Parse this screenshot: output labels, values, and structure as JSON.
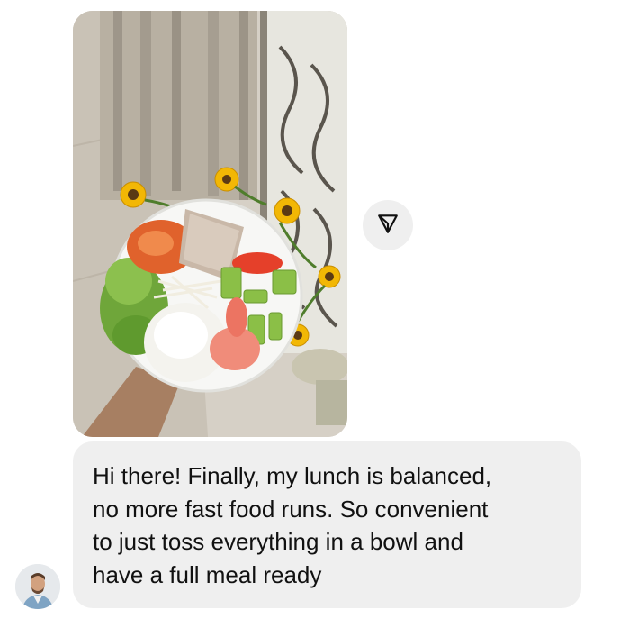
{
  "message": {
    "text": "Hi there! Finally, my lunch is balanced,\nno more fast food runs. So convenient\nto just toss everything in a bowl and\nhave a full meal ready"
  },
  "icons": {
    "share": "paper-plane-icon"
  },
  "colors": {
    "bubble_background": "#efefef",
    "text": "#111111",
    "share_button_background": "#efefef"
  }
}
